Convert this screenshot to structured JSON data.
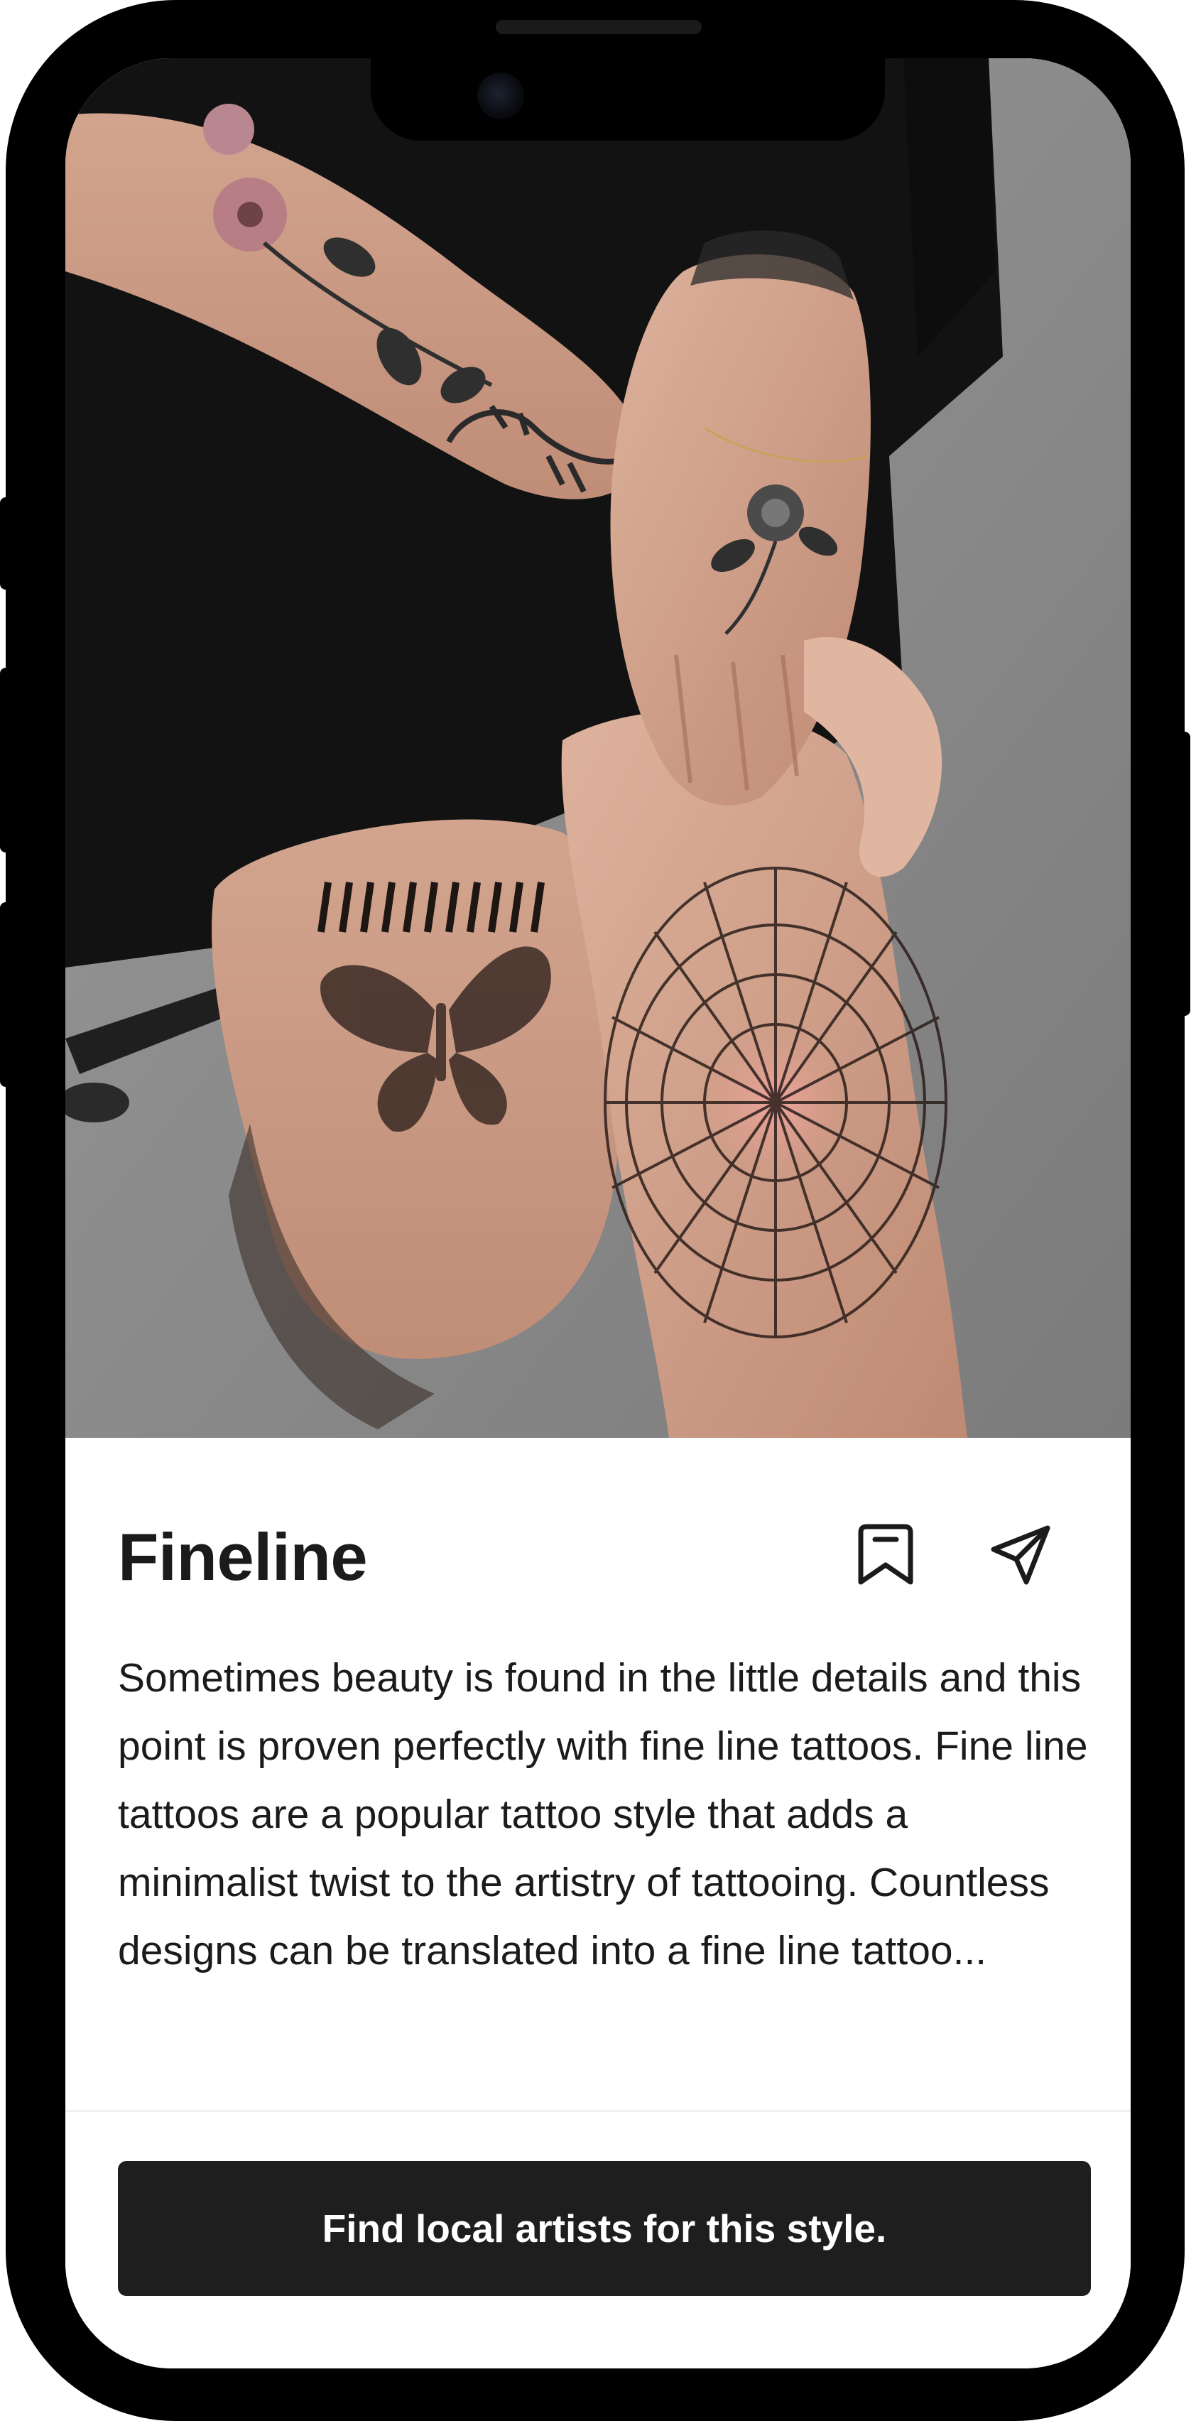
{
  "card": {
    "title": "Fineline",
    "description": "Sometimes beauty is found in the little details and this point is proven perfectly with fine line tattoos. Fine line tattoos are a popular tattoo style that adds a minimalist twist to the artistry of tattooing. Countless designs can be translated into a fine line tattoo...",
    "cta_label": "Find local artists for this style."
  },
  "icons": {
    "bookmark": "bookmark-icon",
    "share": "share-icon"
  },
  "colors": {
    "text": "#1b1b1b",
    "cta_background": "#1e1e1e",
    "cta_text": "#ffffff",
    "device_frame": "#000000"
  }
}
